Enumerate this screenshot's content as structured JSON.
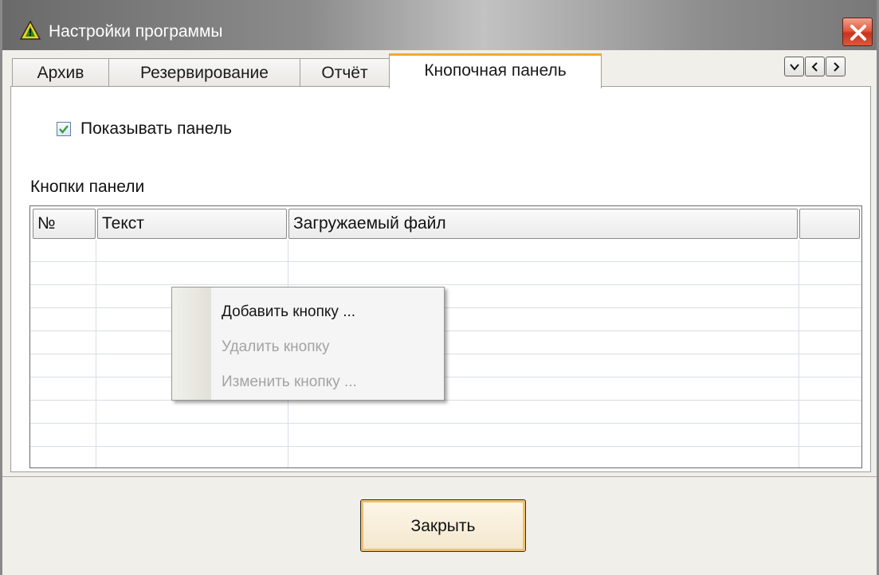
{
  "window": {
    "title": "Настройки программы"
  },
  "tabs": [
    {
      "label": "Архив",
      "active": false
    },
    {
      "label": "Резервирование",
      "active": false
    },
    {
      "label": "Отчёт",
      "active": false
    },
    {
      "label": "Кнопочная панель",
      "active": true
    }
  ],
  "panel": {
    "show_panel_label": "Показывать панель",
    "show_panel_checked": true,
    "group_label": "Кнопки панели"
  },
  "grid": {
    "columns": [
      "№",
      "Текст",
      "Загружаемый файл",
      ""
    ],
    "rows": []
  },
  "context_menu": {
    "items": [
      {
        "label": "Добавить кнопку ...",
        "enabled": true
      },
      {
        "label": "Удалить кнопку",
        "enabled": false
      },
      {
        "label": "Изменить кнопку ...",
        "enabled": false
      }
    ]
  },
  "footer": {
    "close_label": "Закрыть"
  },
  "colors": {
    "active_tab_accent": "#f0a92f",
    "close_button_red": "#d8432a",
    "checkbox_check": "#3c9c3c",
    "default_button_glow": "#f0c070"
  },
  "icons": {
    "title": "warning-triangle-icon",
    "close": "close-x-icon",
    "tab_list": "chevron-down-icon",
    "tab_prev": "chevron-left-icon",
    "tab_next": "chevron-right-icon",
    "checkbox": "checkmark-icon"
  }
}
